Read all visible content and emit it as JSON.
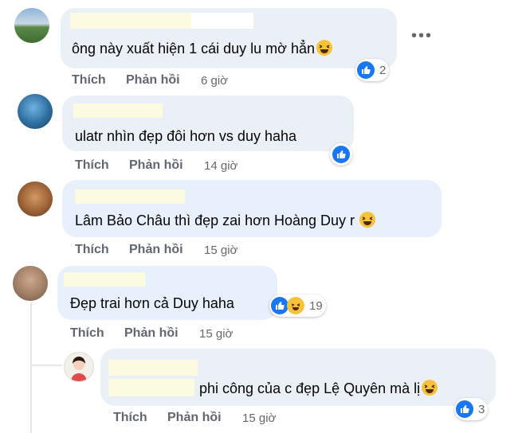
{
  "comments": [
    {
      "text": "ông này xuất hiện 1 cái duy lu mờ hẳn",
      "like": "Thích",
      "reply": "Phản hồi",
      "time": "6 giờ",
      "reactions": "2"
    },
    {
      "text": "ulatr nhìn đẹp đôi hơn vs duy haha",
      "like": "Thích",
      "reply": "Phản hồi",
      "time": "14 giờ"
    },
    {
      "text": "Lâm Bảo Châu thì đẹp zai hơn Hoàng Duy r",
      "like": "Thích",
      "reply": "Phản hồi",
      "time": "15 giờ"
    },
    {
      "text": "Đẹp trai hơn cả Duy haha",
      "like": "Thích",
      "reply": "Phản hồi",
      "time": "15 giờ",
      "reactions": "19"
    },
    {
      "text": "phi công của c đẹp Lệ Quyên mà lị",
      "like": "Thích",
      "reply": "Phản hồi",
      "time": "15 giờ",
      "reactions": "3"
    }
  ],
  "colors": {
    "accent": "#1877f2",
    "haha": "#f7c23b",
    "bubble": "#eaf0f6"
  },
  "icons": [
    "more-options-icon",
    "like-reaction-icon",
    "haha-reaction-icon",
    "laughing-emoji-icon"
  ]
}
